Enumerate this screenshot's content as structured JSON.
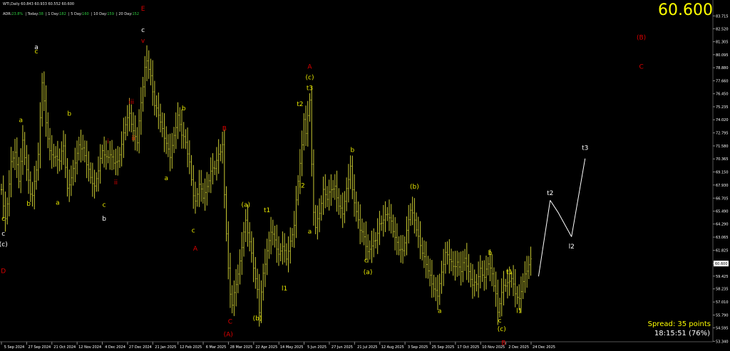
{
  "header": {
    "symbol_line": "WTI,Daily  60.843 60.933 60.552 60.600",
    "adr_label": "ADR:",
    "adr_value": "23.8%",
    "today_label": "Today:",
    "today_value": "38",
    "day1_label": "1 Day:",
    "day1_value": "182",
    "day5_label": "5 Day:",
    "day5_value": "160",
    "day10_label": "10 Day:",
    "day10_value": "159",
    "day20_label": "20 Day:",
    "day20_value": "152"
  },
  "last_price": "60.600",
  "spread_text": "Spread: 35 points",
  "timer_text": "18:15:51 (76%)",
  "colors": {
    "background": "#000000",
    "bars": "#c8c832",
    "label_yellow": "#e6e600",
    "label_white": "#ffffff",
    "label_red": "#dd0000",
    "projection": "#ffffff",
    "axis_text": "#ffffff"
  },
  "chart_data": {
    "type": "ohlc",
    "symbol": "WTI",
    "timeframe": "Daily",
    "ylim": [
      53.3,
      85.0
    ],
    "y_ticks": [
      "83.715",
      "82.520",
      "81.305",
      "80.095",
      "78.880",
      "77.660",
      "76.450",
      "75.235",
      "74.020",
      "72.795",
      "71.580",
      "70.365",
      "69.150",
      "67.930",
      "66.705",
      "65.490",
      "64.290",
      "63.065",
      "61.825",
      "60.600",
      "59.425",
      "58.235",
      "57.010",
      "55.790",
      "54.595",
      "53.340"
    ],
    "current_price_tag": "60.600",
    "x_ticks": [
      "5 Sep 2024",
      "27 Sep 2024",
      "21 Oct 2024",
      "12 Nov 2024",
      "4 Dec 2024",
      "27 Dec 2024",
      "21 Jan 2025",
      "12 Feb 2025",
      "6 Mar 2025",
      "28 Mar 2025",
      "22 Apr 2025",
      "14 May 2025",
      "5 Jun 2025",
      "27 Jun 2025",
      "21 Jul 2025",
      "12 Aug 2025",
      "3 Sep 2025",
      "25 Sep 2025",
      "17 Oct 2025",
      "10 Nov 2025",
      "2 Dec 2025",
      "24 Dec 2025"
    ],
    "price_path": [
      [
        0,
        67.5
      ],
      [
        2,
        64.5
      ],
      [
        3,
        66.0
      ],
      [
        5,
        69.8
      ],
      [
        7,
        71.0
      ],
      [
        9,
        68.5
      ],
      [
        11,
        72.2
      ],
      [
        12,
        70.8
      ],
      [
        13,
        69.5
      ],
      [
        15,
        67.2
      ],
      [
        16,
        66.8
      ],
      [
        19,
        70.5
      ],
      [
        21,
        77.5
      ],
      [
        23,
        73.8
      ],
      [
        25,
        71.2
      ],
      [
        27,
        70.8
      ],
      [
        30,
        70.2
      ],
      [
        32,
        71.5
      ],
      [
        34,
        67.3
      ],
      [
        36,
        68.5
      ],
      [
        38,
        70.2
      ],
      [
        40,
        71.8
      ],
      [
        42,
        71.5
      ],
      [
        44,
        70.0
      ],
      [
        46,
        68.5
      ],
      [
        48,
        67.5
      ],
      [
        50,
        69.2
      ],
      [
        52,
        71.2
      ],
      [
        54,
        70.6
      ],
      [
        56,
        71.0
      ],
      [
        58,
        70.2
      ],
      [
        60,
        70.0
      ],
      [
        62,
        71.5
      ],
      [
        64,
        73.5
      ],
      [
        66,
        74.5
      ],
      [
        68,
        73.0
      ],
      [
        70,
        72.2
      ],
      [
        72,
        75.8
      ],
      [
        74,
        78.8
      ],
      [
        75,
        79.5
      ],
      [
        77,
        77.8
      ],
      [
        79,
        75.2
      ],
      [
        81,
        74.5
      ],
      [
        83,
        73.2
      ],
      [
        85,
        72.0
      ],
      [
        87,
        70.8
      ],
      [
        89,
        72.5
      ],
      [
        91,
        74.2
      ],
      [
        93,
        72.5
      ],
      [
        95,
        71.8
      ],
      [
        97,
        70.0
      ],
      [
        99,
        67.2
      ],
      [
        100,
        66.5
      ],
      [
        102,
        68.2
      ],
      [
        104,
        66.8
      ],
      [
        106,
        67.5
      ],
      [
        108,
        69.0
      ],
      [
        110,
        69.5
      ],
      [
        112,
        70.8
      ],
      [
        114,
        71.8
      ],
      [
        115,
        67.2
      ],
      [
        117,
        60.2
      ],
      [
        118,
        57.8
      ],
      [
        119,
        56.8
      ],
      [
        121,
        58.5
      ],
      [
        123,
        60.5
      ],
      [
        125,
        63.5
      ],
      [
        126,
        64.5
      ],
      [
        128,
        62.8
      ],
      [
        130,
        60.5
      ],
      [
        132,
        58.2
      ],
      [
        133,
        56.2
      ],
      [
        135,
        59.5
      ],
      [
        137,
        61.5
      ],
      [
        139,
        63.5
      ],
      [
        141,
        62.8
      ],
      [
        143,
        61.5
      ],
      [
        145,
        62.5
      ],
      [
        147,
        61.2
      ],
      [
        149,
        62.5
      ],
      [
        151,
        64.0
      ],
      [
        152,
        66.2
      ],
      [
        153,
        68.2
      ],
      [
        154,
        69.8
      ],
      [
        155,
        71.5
      ],
      [
        156,
        74.2
      ],
      [
        157,
        72.8
      ],
      [
        158,
        74.5
      ],
      [
        159,
        76.2
      ],
      [
        160,
        70.0
      ],
      [
        161,
        65.5
      ],
      [
        162,
        64.2
      ],
      [
        164,
        65.2
      ],
      [
        166,
        67.2
      ],
      [
        168,
        66.5
      ],
      [
        170,
        67.5
      ],
      [
        172,
        67.8
      ],
      [
        174,
        66.2
      ],
      [
        176,
        65.5
      ],
      [
        178,
        67.5
      ],
      [
        180,
        69.5
      ],
      [
        181,
        67.2
      ],
      [
        183,
        65.2
      ],
      [
        185,
        63.8
      ],
      [
        187,
        63.2
      ],
      [
        189,
        61.8
      ],
      [
        191,
        62.5
      ],
      [
        193,
        62.8
      ],
      [
        195,
        64.0
      ],
      [
        197,
        64.5
      ],
      [
        199,
        65.2
      ],
      [
        201,
        64.5
      ],
      [
        203,
        63.2
      ],
      [
        205,
        62.2
      ],
      [
        207,
        61.8
      ],
      [
        209,
        63.5
      ],
      [
        211,
        65.5
      ],
      [
        213,
        64.5
      ],
      [
        215,
        63.0
      ],
      [
        217,
        61.8
      ],
      [
        219,
        60.8
      ],
      [
        221,
        59.5
      ],
      [
        223,
        58.2
      ],
      [
        225,
        57.5
      ],
      [
        227,
        59.5
      ],
      [
        229,
        61.5
      ],
      [
        231,
        61.2
      ],
      [
        233,
        60.5
      ],
      [
        235,
        60.8
      ],
      [
        237,
        60.0
      ],
      [
        239,
        61.0
      ],
      [
        241,
        59.5
      ],
      [
        243,
        58.5
      ],
      [
        245,
        58.8
      ],
      [
        247,
        60.2
      ],
      [
        249,
        59.5
      ],
      [
        251,
        60.8
      ],
      [
        253,
        59.5
      ],
      [
        255,
        57.5
      ],
      [
        256,
        55.8
      ],
      [
        257,
        56.8
      ],
      [
        259,
        58.5
      ],
      [
        261,
        58.8
      ],
      [
        263,
        59.5
      ],
      [
        265,
        58.0
      ],
      [
        267,
        57.2
      ],
      [
        269,
        58.8
      ],
      [
        271,
        59.8
      ],
      [
        273,
        60.8
      ]
    ],
    "projection": [
      [
        277,
        59.4
      ],
      [
        283,
        66.5
      ],
      [
        287,
        65.4
      ],
      [
        294,
        63.1
      ],
      [
        301,
        70.4
      ]
    ],
    "wave_labels": [
      {
        "text": "c",
        "color": "yellow",
        "bar": 1,
        "price": 64.6
      },
      {
        "text": "c",
        "color": "white",
        "bar": 1,
        "price": 63.2
      },
      {
        "text": "(c)",
        "color": "white",
        "bar": 1,
        "price": 62.2
      },
      {
        "text": "D",
        "color": "red",
        "bar": 1,
        "price": 59.7
      },
      {
        "text": "b",
        "color": "yellow",
        "bar": 14,
        "price": 66.0
      },
      {
        "text": "a",
        "color": "yellow",
        "bar": 10,
        "price": 73.8
      },
      {
        "text": "a",
        "color": "white",
        "bar": 18,
        "price": 80.6
      },
      {
        "text": "c",
        "color": "yellow",
        "bar": 18,
        "price": 80.2
      },
      {
        "text": "a",
        "color": "yellow",
        "bar": 29,
        "price": 66.1
      },
      {
        "text": "b",
        "color": "yellow",
        "bar": 35,
        "price": 74.4
      },
      {
        "text": "c",
        "color": "yellow",
        "bar": 53,
        "price": 65.9
      },
      {
        "text": "b",
        "color": "white",
        "bar": 53,
        "price": 64.6
      },
      {
        "text": "i",
        "color": "red",
        "bar": 55,
        "price": 71.8
      },
      {
        "text": "ii",
        "color": "red",
        "bar": 59,
        "price": 68.0
      },
      {
        "text": "iii",
        "color": "red",
        "bar": 67,
        "price": 75.5
      },
      {
        "text": "ii",
        "color": "red",
        "bar": 68,
        "price": 72.1
      },
      {
        "text": "c",
        "color": "white",
        "bar": 73,
        "price": 82.2
      },
      {
        "text": "v",
        "color": "red",
        "bar": 73,
        "price": 81.2
      },
      {
        "text": "E",
        "color": "red",
        "bar": 73,
        "price": 84.2
      },
      {
        "text": "a",
        "color": "yellow",
        "bar": 85,
        "price": 68.4
      },
      {
        "text": "b",
        "color": "yellow",
        "bar": 94,
        "price": 74.9
      },
      {
        "text": "c",
        "color": "yellow",
        "bar": 99,
        "price": 63.5
      },
      {
        "text": "A",
        "color": "red",
        "bar": 100,
        "price": 61.8
      },
      {
        "text": "B",
        "color": "red",
        "bar": 115,
        "price": 73.0
      },
      {
        "text": "C",
        "color": "red",
        "bar": 118,
        "price": 55.0
      },
      {
        "text": "(A)",
        "color": "red",
        "bar": 117,
        "price": 53.8
      },
      {
        "text": "(a)",
        "color": "yellow",
        "bar": 126,
        "price": 65.9
      },
      {
        "text": "(b)",
        "color": "yellow",
        "bar": 132,
        "price": 55.3
      },
      {
        "text": "t1",
        "color": "yellow",
        "bar": 137,
        "price": 65.4
      },
      {
        "text": "l1",
        "color": "yellow",
        "bar": 146,
        "price": 58.1
      },
      {
        "text": "t2",
        "color": "yellow",
        "bar": 154,
        "price": 75.3
      },
      {
        "text": "l2",
        "color": "yellow",
        "bar": 155,
        "price": 67.7
      },
      {
        "text": "a",
        "color": "yellow",
        "bar": 159,
        "price": 63.4
      },
      {
        "text": "t3",
        "color": "yellow",
        "bar": 159,
        "price": 76.8
      },
      {
        "text": "(c)",
        "color": "yellow",
        "bar": 159,
        "price": 77.8
      },
      {
        "text": "A",
        "color": "red",
        "bar": 159,
        "price": 78.8
      },
      {
        "text": "b",
        "color": "yellow",
        "bar": 181,
        "price": 71.0
      },
      {
        "text": "c",
        "color": "yellow",
        "bar": 188,
        "price": 60.7
      },
      {
        "text": "(a)",
        "color": "yellow",
        "bar": 189,
        "price": 59.6
      },
      {
        "text": "(b)",
        "color": "yellow",
        "bar": 213,
        "price": 67.6
      },
      {
        "text": "a",
        "color": "yellow",
        "bar": 226,
        "price": 56.0
      },
      {
        "text": "b",
        "color": "yellow",
        "bar": 252,
        "price": 61.4
      },
      {
        "text": "t1",
        "color": "yellow",
        "bar": 262,
        "price": 59.6
      },
      {
        "text": "c",
        "color": "yellow",
        "bar": 257,
        "price": 55.1
      },
      {
        "text": "(c)",
        "color": "yellow",
        "bar": 258,
        "price": 54.3
      },
      {
        "text": "l1",
        "color": "yellow",
        "bar": 267,
        "price": 56.0
      },
      {
        "text": "B",
        "color": "red",
        "bar": 259,
        "price": 53.0
      },
      {
        "text": "t2",
        "color": "white",
        "bar": 283,
        "price": 67.0
      },
      {
        "text": "l2",
        "color": "white",
        "bar": 294,
        "price": 62.0
      },
      {
        "text": "t3",
        "color": "white",
        "bar": 301,
        "price": 71.2
      },
      {
        "text": "(B)",
        "color": "red",
        "bar": 330,
        "price": 81.5
      },
      {
        "text": "C",
        "color": "red",
        "bar": 330,
        "price": 78.8
      }
    ]
  }
}
